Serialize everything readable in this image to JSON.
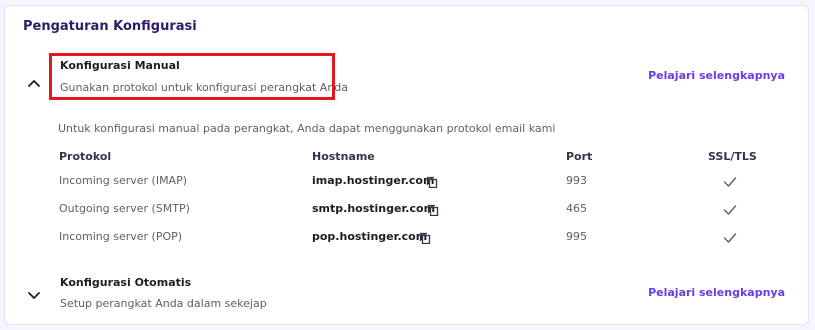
{
  "card": {
    "title": "Pengaturan Konfigurasi"
  },
  "manual": {
    "title": "Konfigurasi Manual",
    "subtitle": "Gunakan protokol untuk konfigurasi perangkat Anda",
    "link": "Pelajari selengkapnya",
    "expanded": true,
    "intro": "Untuk konfigurasi manual pada perangkat, Anda dapat menggunakan protokol email kami",
    "table": {
      "headers": [
        "Protokol",
        "Hostname",
        "Port",
        "SSL/TLS"
      ],
      "rows": [
        {
          "protocol": "Incoming server (IMAP)",
          "hostname": "imap.hostinger.com",
          "port": "993",
          "ssl": true
        },
        {
          "protocol": "Outgoing server (SMTP)",
          "hostname": "smtp.hostinger.com",
          "port": "465",
          "ssl": true
        },
        {
          "protocol": "Incoming server (POP)",
          "hostname": "pop.hostinger.com",
          "port": "995",
          "ssl": true
        }
      ]
    }
  },
  "automatic": {
    "title": "Konfigurasi Otomatis",
    "subtitle": "Setup perangkat Anda dalam sekejap",
    "link": "Pelajari selengkapnya",
    "expanded": false
  },
  "icons": {
    "expand": "chevron-up-icon",
    "collapse": "chevron-down-icon",
    "copy": "copy-icon",
    "check": "check-icon"
  },
  "colors": {
    "link": "#673de6",
    "highlight": "#e5171e",
    "title": "#2f1c6a"
  }
}
